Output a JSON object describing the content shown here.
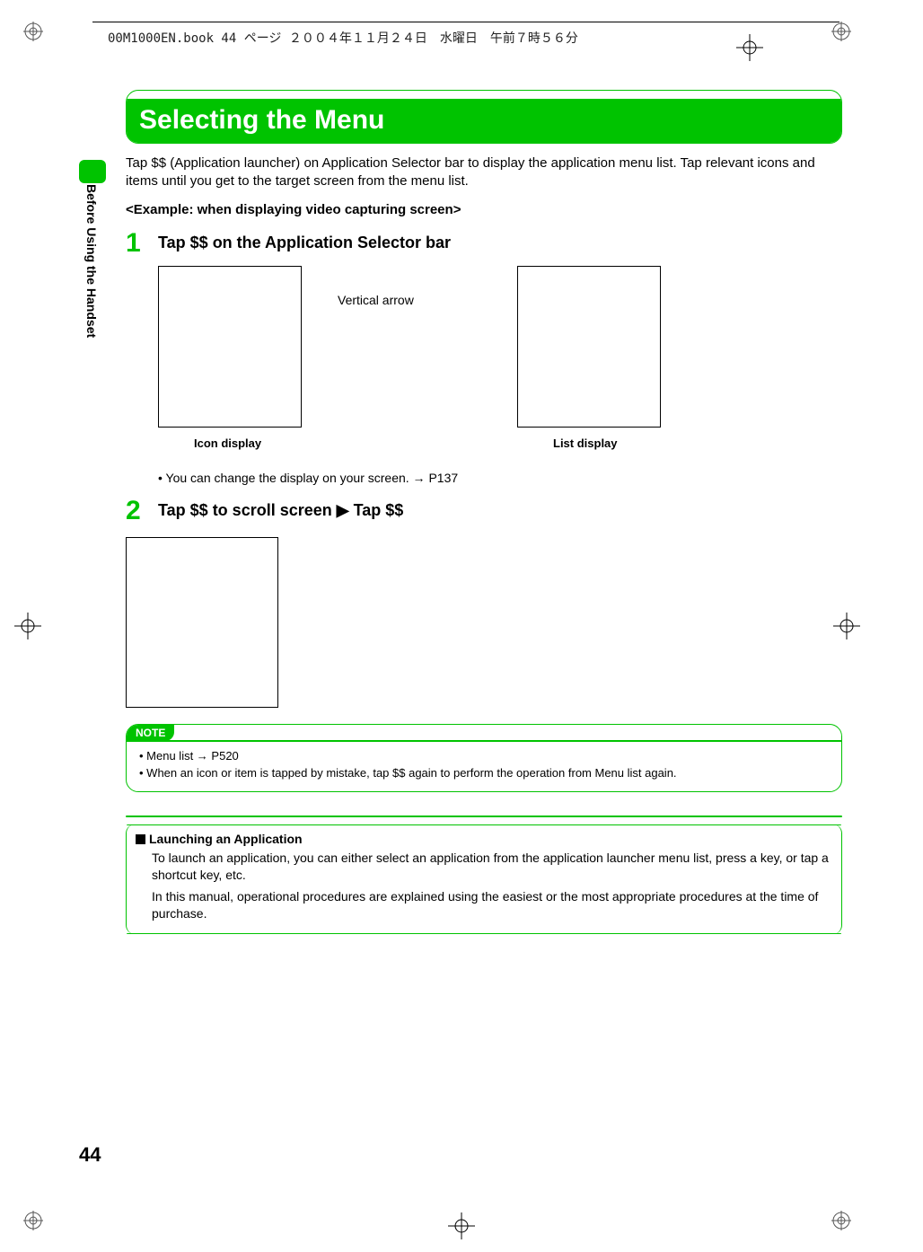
{
  "meta_header": "00M1000EN.book  44 ページ  ２００４年１１月２４日　水曜日　午前７時５６分",
  "side_label": "Before Using the Handset",
  "title": "Selecting the Menu",
  "intro": "Tap $$ (Application launcher) on Application Selector bar to display the application menu list. Tap relevant icons and items until you get to the target screen from the menu list.",
  "example_heading": "<Example: when displaying video capturing screen>",
  "step1": {
    "num": "1",
    "title": "Tap $$ on the Application Selector bar",
    "vertical_arrow_label": "Vertical arrow",
    "icon_caption": "Icon display",
    "list_caption": "List display",
    "bullet": "You can change the display on your screen. → P137"
  },
  "step2": {
    "num": "2",
    "title": "Tap $$ to scroll screen ▶ Tap $$"
  },
  "note": {
    "heading": "NOTE",
    "items": [
      "Menu list → P520",
      "When an icon or item is tapped by mistake, tap $$ again to perform the operation from Menu list again."
    ]
  },
  "launch": {
    "heading": "Launching an Application",
    "p1": "To launch an application, you can either select an application from the application launcher menu list, press a key, or tap a shortcut key, etc.",
    "p2": "In this manual, operational procedures are explained using the easiest or the most appropriate procedures at the time of purchase."
  },
  "page_number": "44"
}
